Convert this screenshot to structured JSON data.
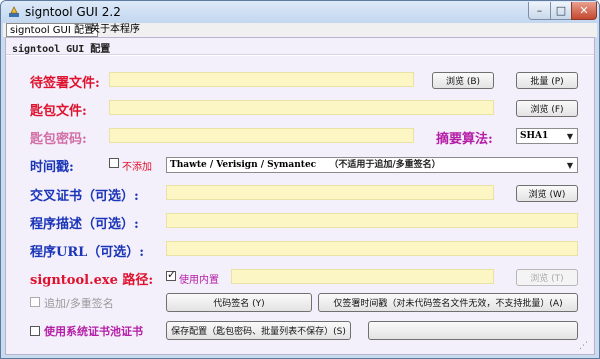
{
  "window": {
    "title": "signtool GUI 2.2",
    "controls": {
      "minimize": "–",
      "maximize": "□",
      "close": "✕"
    }
  },
  "menu": {
    "items": [
      {
        "label": "signtool GUI 配置",
        "active": true
      },
      {
        "label": "关于本程序",
        "active": false
      }
    ]
  },
  "panel": {
    "title": "signtool GUI 配置"
  },
  "form": {
    "file_to_sign": {
      "label": "待签署文件:",
      "value": "",
      "browse_label": "浏览 (B)",
      "batch_label": "批量 (P)"
    },
    "key_file": {
      "label": "匙包文件:",
      "value": "",
      "browse_label": "浏览 (F)"
    },
    "key_password": {
      "label": "匙包密码:",
      "value": ""
    },
    "digest": {
      "label": "摘要算法:",
      "value": "SHA1"
    },
    "timestamp": {
      "label": "时间戳:",
      "no_add_label": "不添加",
      "no_add_checked": false,
      "server_value": "Thawte / Verisign / Symantec",
      "server_note": "（不适用于追加/多重签名）"
    },
    "cross_cert": {
      "label": "交叉证书（可选）:",
      "value": "",
      "browse_label": "浏览 (W)"
    },
    "description": {
      "label": "程序描述（可选）:",
      "value": ""
    },
    "url": {
      "label": "程序URL（可选）:",
      "value": ""
    },
    "signtool_path": {
      "label": "signtool.exe 路径:",
      "builtin_label": "使用内置",
      "builtin_checked": true,
      "value": "",
      "browse_label": "浏览 (T)"
    },
    "append_sign": {
      "label": "追加/多重签名",
      "checked": false
    },
    "system_store": {
      "label": "使用系统证书池证书",
      "checked": false
    }
  },
  "actions": {
    "code_sign": "代码签名 (Y)",
    "timestamp_only": "仅签署时间戳（对未代码签名文件无效，不支持批量）(A)",
    "save_config": "保存配置（匙包密码、批量列表不保存）(S)"
  },
  "colors": {
    "label_red": "#e0112c",
    "label_pink": "#d26fa5",
    "label_blue": "#1b35b8",
    "label_magenta": "#b51ea6",
    "field_bg": "#fbf6c4",
    "panel_bg": "#f3effb"
  }
}
